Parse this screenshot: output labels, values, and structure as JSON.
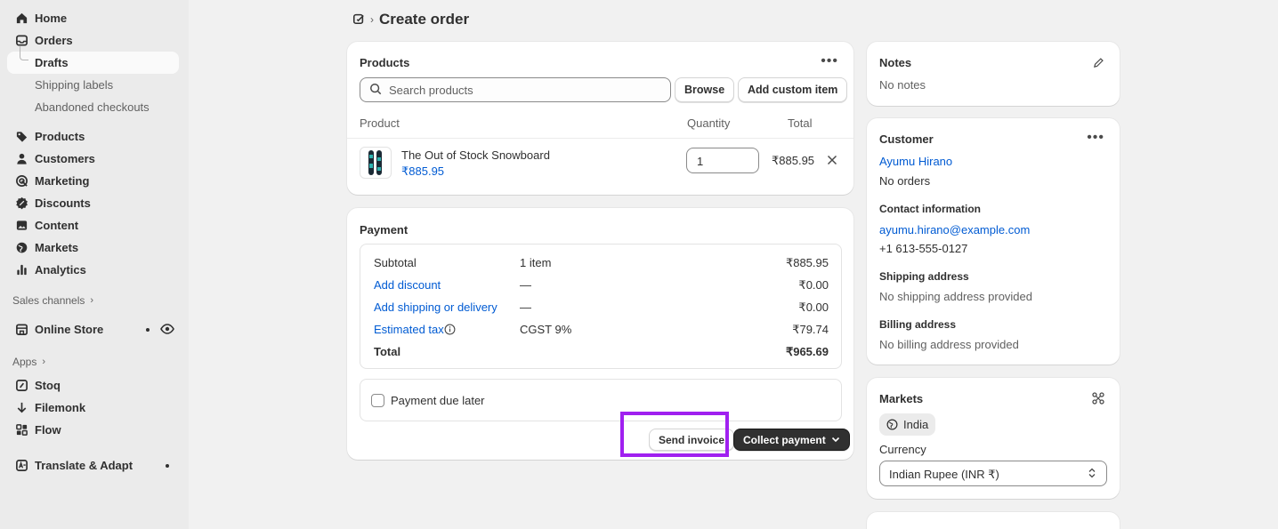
{
  "sidebar": {
    "home": "Home",
    "orders": "Orders",
    "drafts": "Drafts",
    "shipping_labels": "Shipping labels",
    "abandoned_checkouts": "Abandoned checkouts",
    "products": "Products",
    "customers": "Customers",
    "marketing": "Marketing",
    "discounts": "Discounts",
    "content": "Content",
    "markets": "Markets",
    "analytics": "Analytics",
    "sales_channels": "Sales channels",
    "online_store": "Online Store",
    "apps": "Apps",
    "stoq": "Stoq",
    "filemonk": "Filemonk",
    "flow": "Flow",
    "translate_adapt": "Translate & Adapt"
  },
  "header": {
    "title": "Create order"
  },
  "products_card": {
    "title": "Products",
    "search_placeholder": "Search products",
    "browse_label": "Browse",
    "add_custom_label": "Add custom item",
    "columns": {
      "product": "Product",
      "quantity": "Quantity",
      "total": "Total"
    },
    "items": [
      {
        "name": "The Out of Stock Snowboard",
        "price": "₹885.95",
        "quantity": "1",
        "total": "₹885.95"
      }
    ]
  },
  "payment_card": {
    "title": "Payment",
    "rows": [
      {
        "label": "Subtotal",
        "detail": "1 item",
        "amount": "₹885.95"
      },
      {
        "label": "Add discount",
        "detail": "—",
        "amount": "₹0.00"
      },
      {
        "label": "Add shipping or delivery",
        "detail": "—",
        "amount": "₹0.00"
      },
      {
        "label": "Estimated tax",
        "detail": "CGST 9%",
        "amount": "₹79.74"
      },
      {
        "label": "Total",
        "detail": "",
        "amount": "₹965.69"
      }
    ],
    "due_later_label": "Payment due later",
    "send_invoice_label": "Send invoice",
    "collect_payment_label": "Collect payment"
  },
  "notes_card": {
    "title": "Notes",
    "text": "No notes"
  },
  "customer_card": {
    "title": "Customer",
    "name": "Ayumu Hirano",
    "orders": "No orders",
    "contact_heading": "Contact information",
    "email": "ayumu.hirano@example.com",
    "phone": "+1 613-555-0127",
    "shipping_heading": "Shipping address",
    "shipping_text": "No shipping address provided",
    "billing_heading": "Billing address",
    "billing_text": "No billing address provided"
  },
  "markets_card": {
    "title": "Markets",
    "market_badge": "India",
    "currency_label": "Currency",
    "currency_value": "Indian Rupee (INR ₹)"
  },
  "colors": {
    "accent": "#005bd3",
    "highlight": "#a020f0",
    "primary_button": "#303030"
  }
}
